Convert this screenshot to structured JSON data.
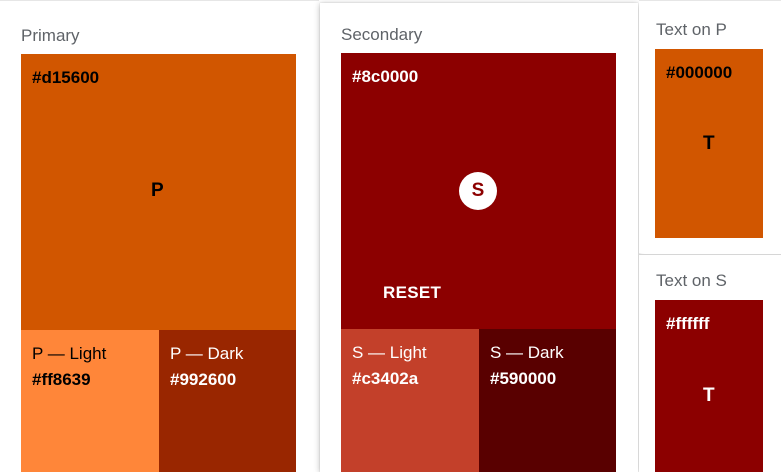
{
  "colors": {
    "primary": "#d15600",
    "primary_light": "#ff8639",
    "primary_dark": "#992600",
    "secondary": "#8c0000",
    "secondary_light": "#c3402a",
    "secondary_dark": "#590000",
    "on_primary": "#000000",
    "on_secondary": "#ffffff"
  },
  "primary": {
    "title": "Primary",
    "hex": "#d15600",
    "letter": "P",
    "light": {
      "label": "P — Light",
      "hex": "#ff8639"
    },
    "dark": {
      "label": "P — Dark",
      "hex": "#992600"
    }
  },
  "secondary": {
    "title": "Secondary",
    "hex": "#8c0000",
    "fab_letter": "S",
    "reset_label": "RESET",
    "light": {
      "label": "S — Light",
      "hex": "#c3402a"
    },
    "dark": {
      "label": "S — Dark",
      "hex": "#590000"
    }
  },
  "text_on_primary": {
    "title": "Text on P",
    "hex": "#000000",
    "letter": "T"
  },
  "text_on_secondary": {
    "title": "Text on S",
    "hex": "#ffffff",
    "letter": "T"
  }
}
